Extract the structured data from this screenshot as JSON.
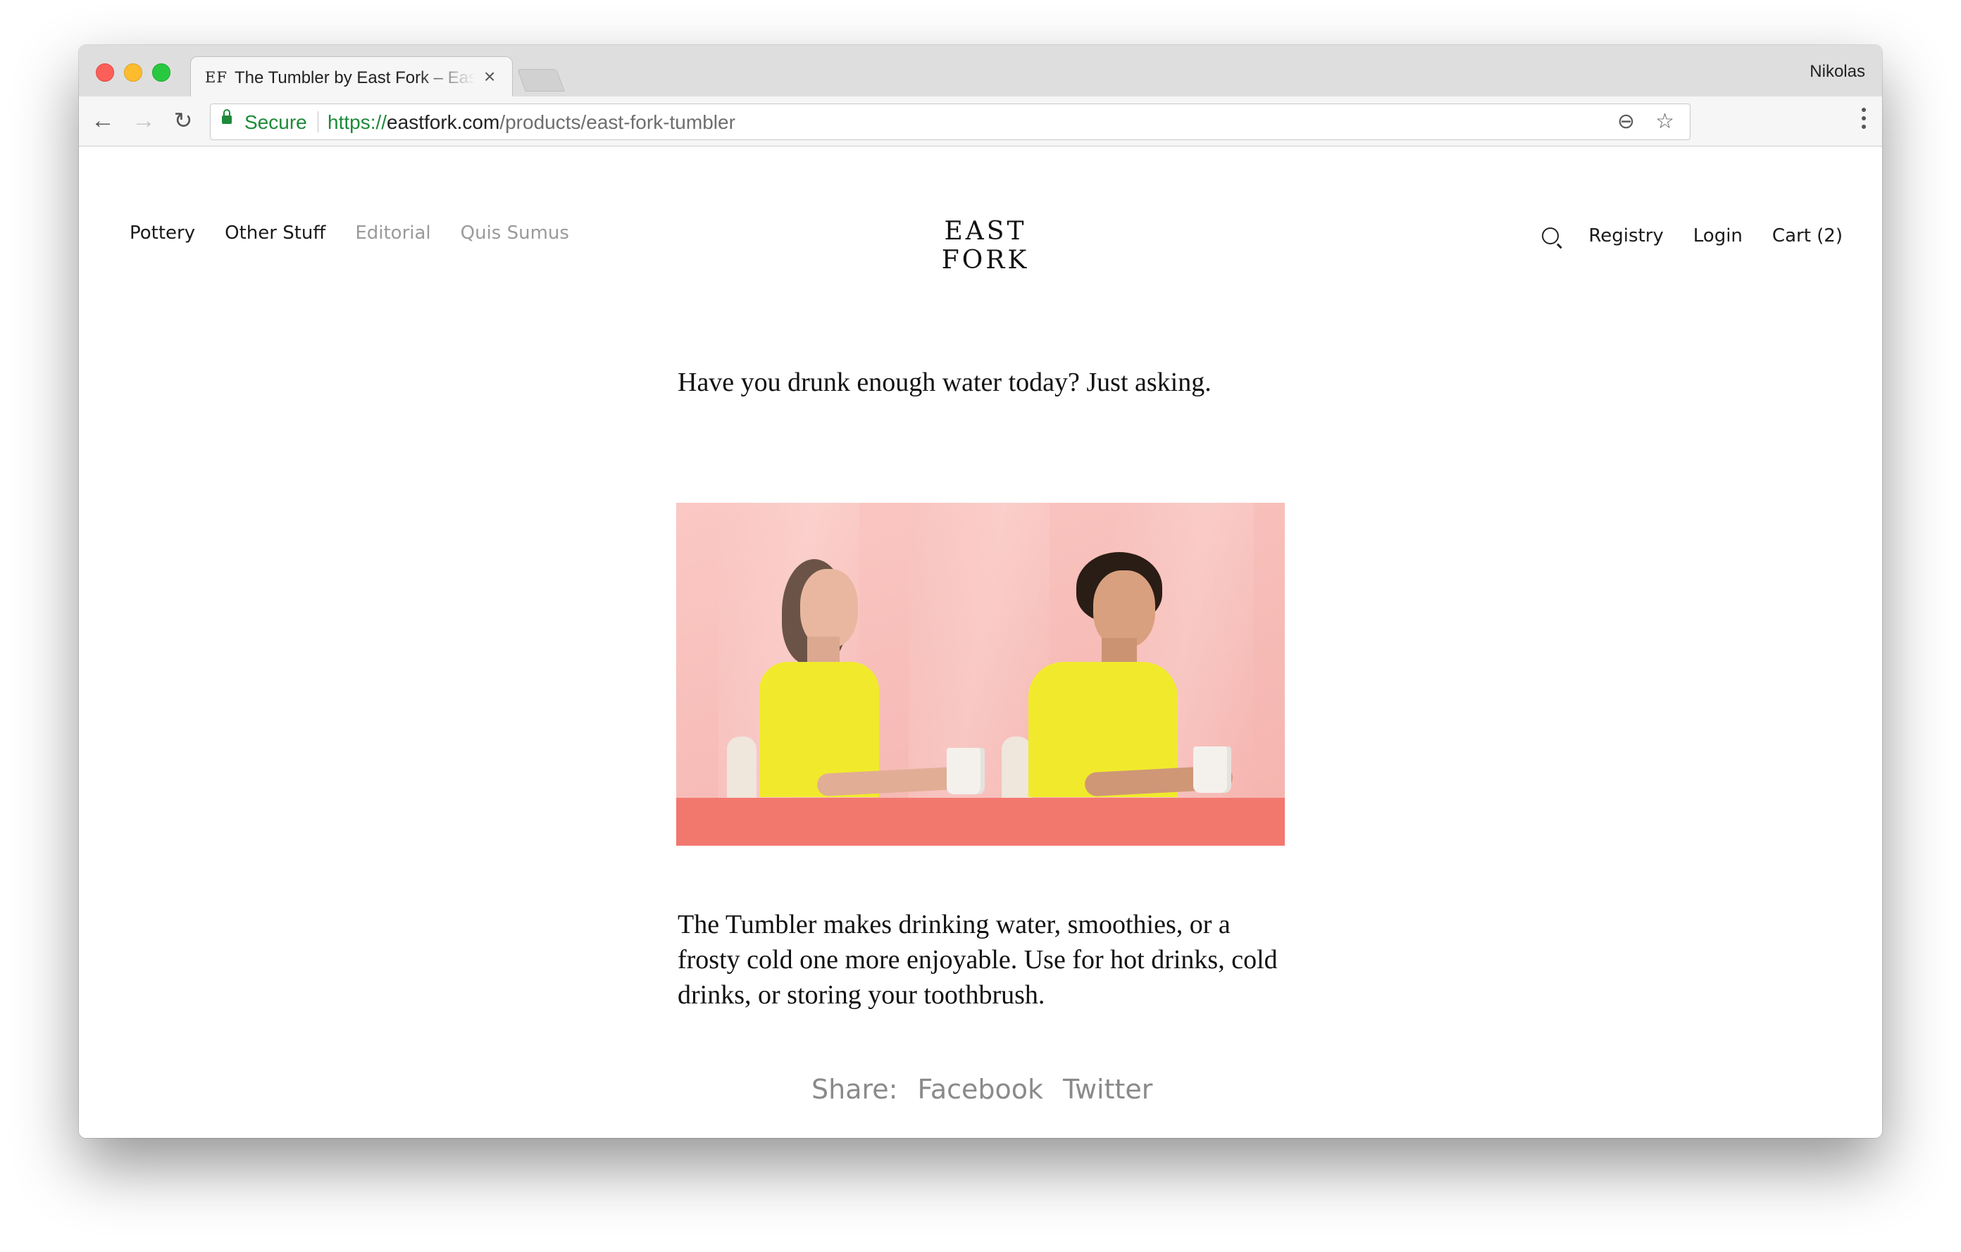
{
  "browser": {
    "profile_name": "Nikolas",
    "tab": {
      "favicon_text": "EF",
      "title": "The Tumbler by East Fork – East Fork",
      "close_glyph": "×"
    },
    "omnibox": {
      "secure_label": "Secure",
      "url_scheme": "https://",
      "url_host": "eastfork.com",
      "url_path": "/products/east-fork-tumbler"
    },
    "icons": {
      "back": "←",
      "forward": "→",
      "reload": "↻",
      "zoom": "⊖",
      "star": "☆"
    }
  },
  "site": {
    "nav_left": [
      {
        "label": "Pottery",
        "style": "dark"
      },
      {
        "label": "Other Stuff",
        "style": "dark"
      },
      {
        "label": "Editorial",
        "style": "muted"
      },
      {
        "label": "Quis Sumus",
        "style": "muted"
      }
    ],
    "logo": "EAST FORK",
    "nav_right": {
      "registry": "Registry",
      "login": "Login",
      "cart": "Cart (2)"
    }
  },
  "content": {
    "intro": "Have you drunk enough water today?  Just asking.",
    "body": "The Tumbler makes drinking water, smoothies, or a frosty cold one more enjoyable. Use for hot drinks, cold drinks, or storing your toothbrush.",
    "share": {
      "label": "Share:",
      "facebook": "Facebook",
      "twitter": "Twitter"
    }
  },
  "colors": {
    "secure_green": "#1e8a3a",
    "photo_backdrop": "#f7bdb8",
    "table_coral": "#f2786e",
    "shirt_yellow": "#f1ea2c"
  }
}
